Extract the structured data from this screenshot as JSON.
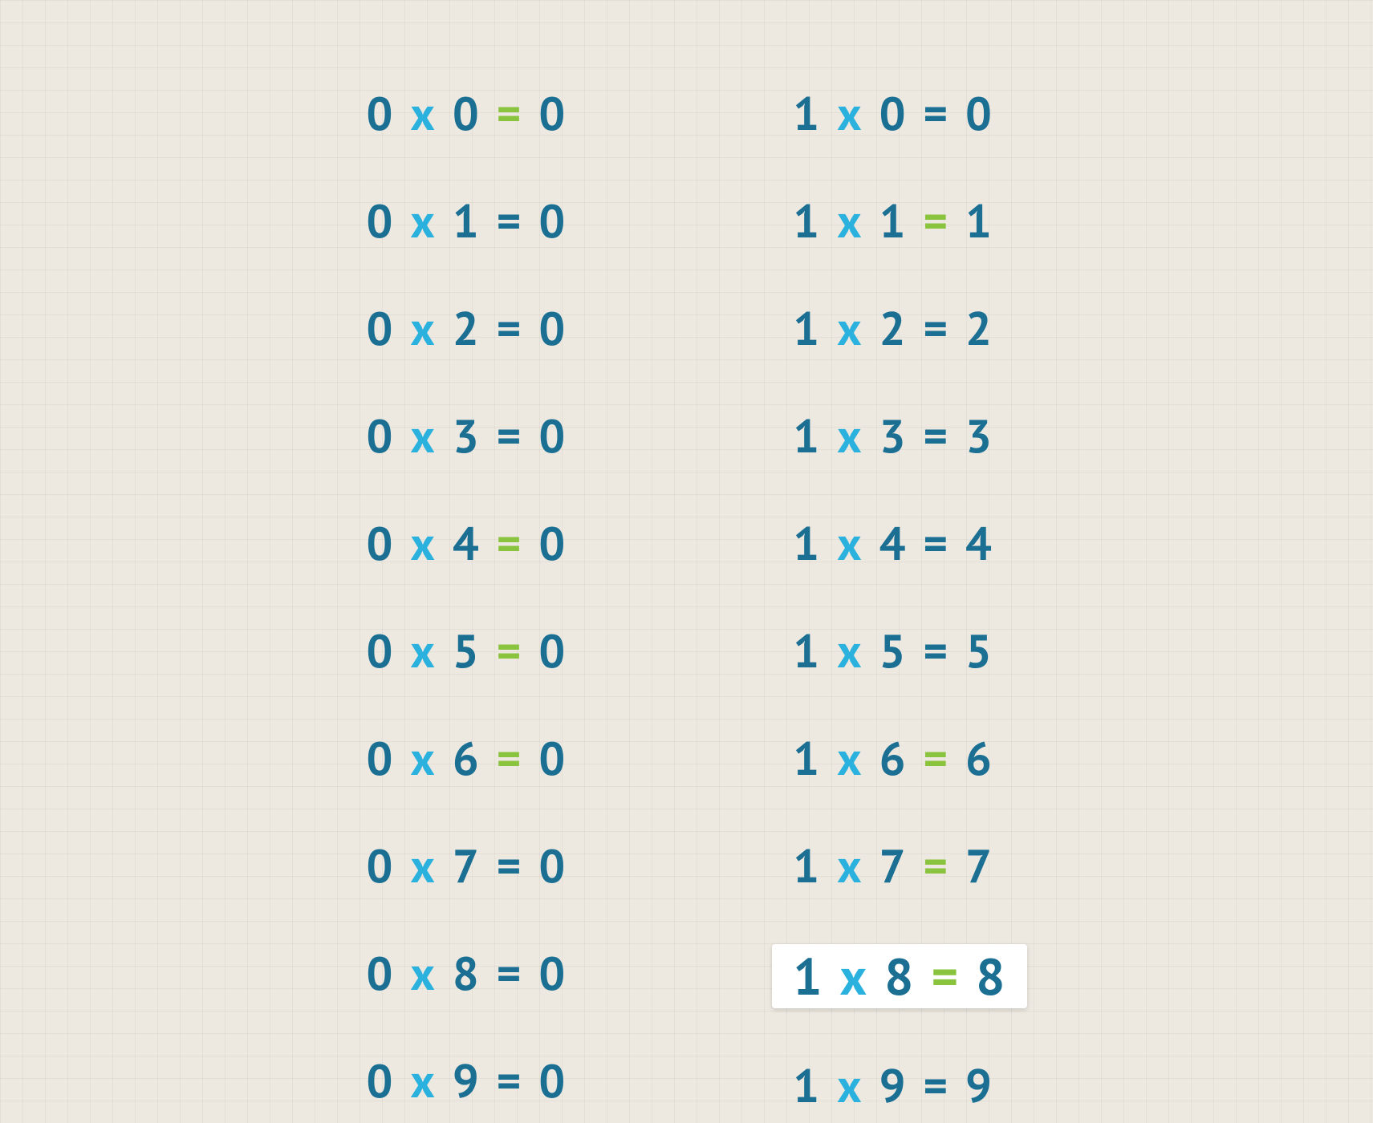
{
  "colors": {
    "blue": "#1b6f93",
    "light": "#2bb1dd",
    "green": "#8ac43f",
    "bg": "#ede9e1"
  },
  "columns": [
    {
      "rows": [
        {
          "a": "0",
          "x": "x",
          "b": "0",
          "eq": "=",
          "r": "0",
          "eqColor": "green",
          "highlight": false
        },
        {
          "a": "0",
          "x": "x",
          "b": "1",
          "eq": "=",
          "r": "0",
          "eqColor": "blue",
          "highlight": false
        },
        {
          "a": "0",
          "x": "x",
          "b": "2",
          "eq": "=",
          "r": "0",
          "eqColor": "blue",
          "highlight": false
        },
        {
          "a": "0",
          "x": "x",
          "b": "3",
          "eq": "=",
          "r": "0",
          "eqColor": "blue",
          "highlight": false
        },
        {
          "a": "0",
          "x": "x",
          "b": "4",
          "eq": "=",
          "r": "0",
          "eqColor": "green",
          "highlight": false
        },
        {
          "a": "0",
          "x": "x",
          "b": "5",
          "eq": "=",
          "r": "0",
          "eqColor": "green",
          "highlight": false
        },
        {
          "a": "0",
          "x": "x",
          "b": "6",
          "eq": "=",
          "r": "0",
          "eqColor": "green",
          "highlight": false
        },
        {
          "a": "0",
          "x": "x",
          "b": "7",
          "eq": "=",
          "r": "0",
          "eqColor": "blue",
          "highlight": false
        },
        {
          "a": "0",
          "x": "x",
          "b": "8",
          "eq": "=",
          "r": "0",
          "eqColor": "blue",
          "highlight": false
        },
        {
          "a": "0",
          "x": "x",
          "b": "9",
          "eq": "=",
          "r": "0",
          "eqColor": "blue",
          "highlight": false
        }
      ]
    },
    {
      "rows": [
        {
          "a": "1",
          "x": "x",
          "b": "0",
          "eq": "=",
          "r": "0",
          "eqColor": "blue",
          "highlight": false
        },
        {
          "a": "1",
          "x": "x",
          "b": "1",
          "eq": "=",
          "r": "1",
          "eqColor": "green",
          "highlight": false
        },
        {
          "a": "1",
          "x": "x",
          "b": "2",
          "eq": "=",
          "r": "2",
          "eqColor": "blue",
          "highlight": false
        },
        {
          "a": "1",
          "x": "x",
          "b": "3",
          "eq": "=",
          "r": "3",
          "eqColor": "blue",
          "highlight": false
        },
        {
          "a": "1",
          "x": "x",
          "b": "4",
          "eq": "=",
          "r": "4",
          "eqColor": "blue",
          "highlight": false
        },
        {
          "a": "1",
          "x": "x",
          "b": "5",
          "eq": "=",
          "r": "5",
          "eqColor": "blue",
          "highlight": false
        },
        {
          "a": "1",
          "x": "x",
          "b": "6",
          "eq": "=",
          "r": "6",
          "eqColor": "green",
          "highlight": false
        },
        {
          "a": "1",
          "x": "x",
          "b": "7",
          "eq": "=",
          "r": "7",
          "eqColor": "green",
          "highlight": false
        },
        {
          "a": "1",
          "x": "x",
          "b": "8",
          "eq": "=",
          "r": "8",
          "eqColor": "green",
          "highlight": true
        },
        {
          "a": "1",
          "x": "x",
          "b": "9",
          "eq": "=",
          "r": "9",
          "eqColor": "blue",
          "highlight": false
        }
      ]
    }
  ]
}
